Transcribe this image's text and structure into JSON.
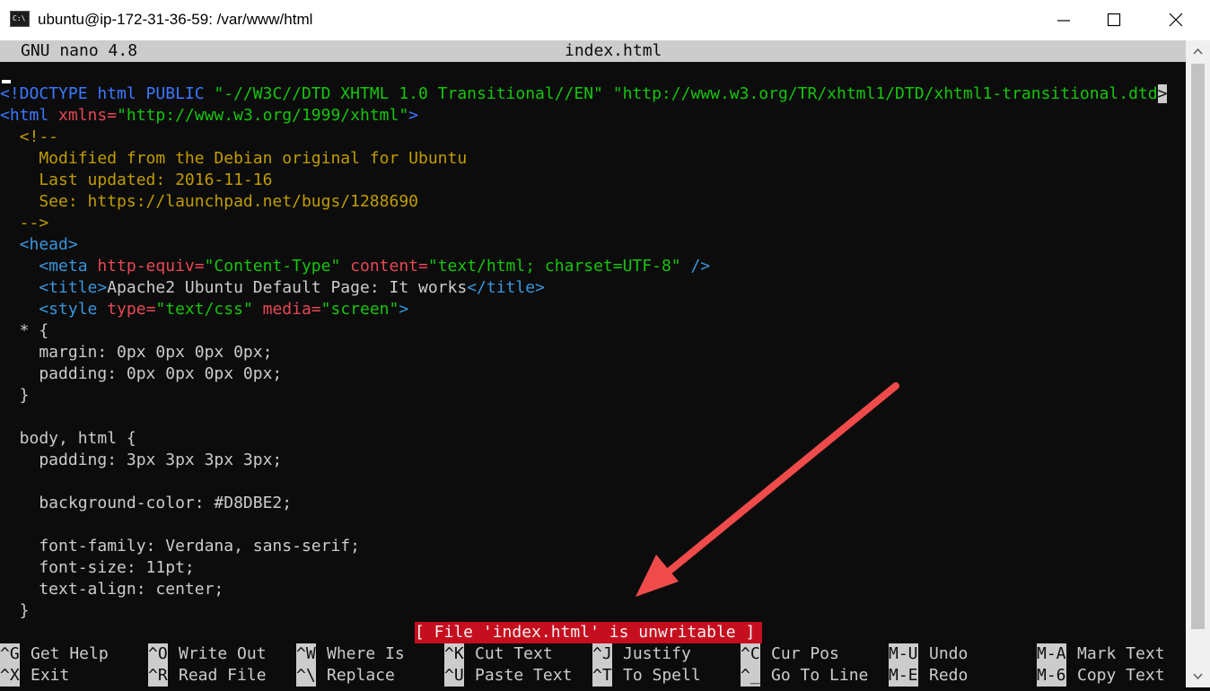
{
  "window": {
    "title": "ubuntu@ip-172-31-36-59: /var/www/html",
    "icon": "terminal-icon",
    "controls": [
      "minimize-icon",
      "maximize-icon",
      "close-icon"
    ]
  },
  "nano": {
    "version": "GNU nano 4.8",
    "filename": "index.html",
    "status_message": "[ File 'index.html' is unwritable ]"
  },
  "code": {
    "l1a": "<!DOCTYPE html PUBLIC ",
    "l1b": "\"-//W3C//DTD XHTML 1.0 Transitional//EN\"",
    "l1c": " ",
    "l1d": "\"http://www.w3.org/TR/xhtml1/DTD/xhtml1-transitional.dtd",
    "l1e": ">",
    "l2a": "<html ",
    "l2b": "xmlns=",
    "l2c": "\"http://www.w3.org/1999/xhtml\"",
    "l2d": ">",
    "l3": "  <!--",
    "l4": "    Modified from the Debian original for Ubuntu",
    "l5": "    Last updated: 2016-11-16",
    "l6": "    See: https://launchpad.net/bugs/1288690",
    "l7": "  -->",
    "l8": "  <head>",
    "l9a": "    <meta ",
    "l9b": "http-equiv=",
    "l9c": "\"Content-Type\"",
    "l9d": " ",
    "l9e": "content=",
    "l9f": "\"text/html; charset=UTF-8\"",
    "l9g": " />",
    "l10a": "    <title>",
    "l10b": "Apache2 Ubuntu Default Page: It works",
    "l10c": "</title>",
    "l11a": "    <style ",
    "l11b": "type=",
    "l11c": "\"text/css\"",
    "l11d": " ",
    "l11e": "media=",
    "l11f": "\"screen\"",
    "l11g": ">",
    "l12": "  * {",
    "l13": "    margin: 0px 0px 0px 0px;",
    "l14": "    padding: 0px 0px 0px 0px;",
    "l15": "  }",
    "l16": "",
    "l17": "  body, html {",
    "l18": "    padding: 3px 3px 3px 3px;",
    "l19": "",
    "l20": "    background-color: #D8DBE2;",
    "l21": "",
    "l22": "    font-family: Verdana, sans-serif;",
    "l23": "    font-size: 11pt;",
    "l24": "    text-align: center;",
    "l25": "  }"
  },
  "shortcuts": [
    {
      "key": "^G",
      "label": "Get Help"
    },
    {
      "key": "^O",
      "label": "Write Out"
    },
    {
      "key": "^W",
      "label": "Where Is"
    },
    {
      "key": "^K",
      "label": "Cut Text"
    },
    {
      "key": "^J",
      "label": "Justify"
    },
    {
      "key": "^C",
      "label": "Cur Pos"
    },
    {
      "key": "M-U",
      "label": "Undo"
    },
    {
      "key": "M-A",
      "label": "Mark Text"
    },
    {
      "key": "^X",
      "label": "Exit"
    },
    {
      "key": "^R",
      "label": "Read File"
    },
    {
      "key": "^\\",
      "label": "Replace"
    },
    {
      "key": "^U",
      "label": "Paste Text"
    },
    {
      "key": "^T",
      "label": "To Spell"
    },
    {
      "key": "^_",
      "label": "Go To Line"
    },
    {
      "key": "M-E",
      "label": "Redo"
    },
    {
      "key": "M-6",
      "label": "Copy Text"
    }
  ],
  "colors": {
    "annotation_arrow": "#ef4b4b",
    "status_bg": "#c50f1f"
  }
}
